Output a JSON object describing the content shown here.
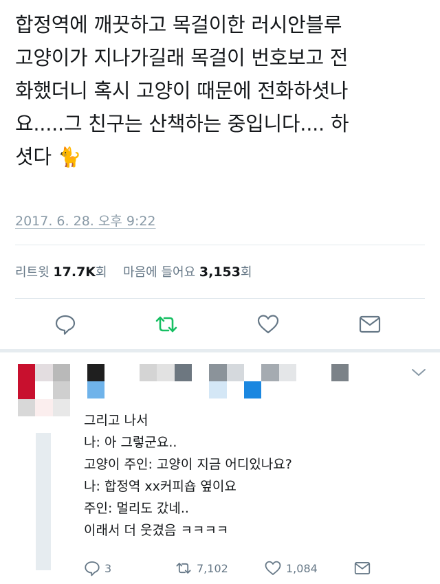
{
  "tweet": {
    "lines": [
      "합정역에 깨끗하고 목걸이한 러시안블루",
      "고양이가 지나가길래 목걸이 번호보고 전",
      "화했더니 혹시 고양이 때문에 전화하셧나",
      "요.....그 친구는 산책하는 중입니다.... 하",
      "셧다"
    ],
    "emoji": "🐈",
    "timestamp": "2017. 6. 28. 오후 9:22"
  },
  "stats": {
    "retweets_label": "리트윗",
    "retweets_value": "17.7K",
    "retweets_unit": "회",
    "likes_label": "마음에 들어요",
    "likes_value": "3,153",
    "likes_unit": "회"
  },
  "actions": {
    "reply_icon": "reply-icon",
    "retweet_icon": "retweet-icon",
    "like_icon": "heart-icon",
    "dm_icon": "envelope-icon",
    "retweet_color": "#17bf63",
    "icon_color": "#657786"
  },
  "reply": {
    "avatar_mosaic": [
      "#c8102e",
      "#e3dde0",
      "#b9b9b9",
      "#c8102e",
      "#ffffff",
      "#cfcfcf",
      "#d8d8d8",
      "#fbeeee",
      "#e8e8e8"
    ],
    "name_mosaic_a": [
      "#1f1f1f",
      "#ffffff",
      "#ffffff",
      "#d4d4d4",
      "#e2e2e2",
      "#6d7780",
      "#ffffff",
      "#8b939a",
      "#d5d9dd",
      "#ffffff",
      "#a5abb1",
      "#e4e6e8",
      "#ffffff",
      "#ffffff",
      "#7b8288"
    ],
    "name_mosaic_b": [
      "#6fb3ea",
      "#ffffff",
      "#ffffff",
      "#ffffff",
      "#ffffff",
      "#ffffff",
      "#ffffff",
      "#d4e7f6",
      "#ffffff",
      "#1b87e0",
      "#ffffff",
      "#ffffff",
      "#ffffff",
      "#ffffff",
      "#ffffff"
    ],
    "lines": [
      "그리고 나서",
      "나: 아 그렇군요..",
      "고양이 주인: 고양이 지금 어디있나요?",
      "나: 합정역 xx커피숍 옆이요",
      "주인: 멀리도 갔네..",
      "이래서 더 웃겼음 ㅋㅋㅋㅋ"
    ],
    "reply_count": "3",
    "retweet_count": "7,102",
    "like_count": "1,084"
  }
}
